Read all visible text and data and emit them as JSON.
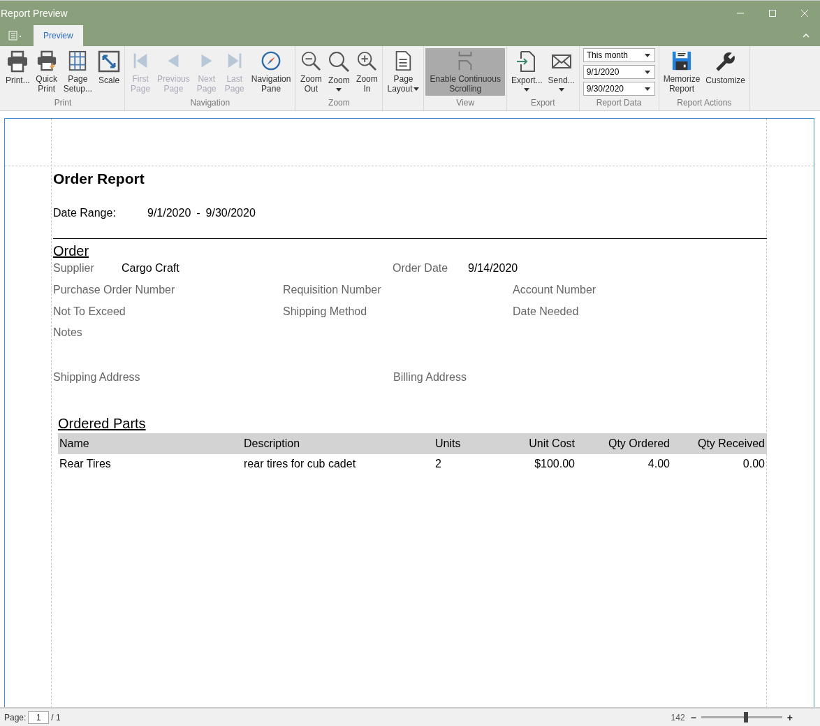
{
  "window": {
    "title": "Report Preview"
  },
  "tabs": [
    {
      "label": "Preview",
      "selected": true
    }
  ],
  "ribbon": [
    {
      "label": "Print",
      "buttons": [
        {
          "lines": [
            "Print..."
          ],
          "disabled": false
        },
        {
          "lines": [
            "Quick",
            "Print"
          ],
          "disabled": false
        },
        {
          "lines": [
            "Page",
            "Setup..."
          ],
          "disabled": false
        },
        {
          "lines": [
            "Scale"
          ],
          "disabled": false
        }
      ]
    },
    {
      "label": "Navigation",
      "buttons": [
        {
          "lines": [
            "First",
            "Page"
          ],
          "disabled": true
        },
        {
          "lines": [
            "Previous",
            "Page"
          ],
          "disabled": true
        },
        {
          "lines": [
            "Next",
            "Page"
          ],
          "disabled": true
        },
        {
          "lines": [
            "Last",
            "Page"
          ],
          "disabled": true
        },
        {
          "lines": [
            "Navigation",
            "Pane"
          ],
          "disabled": false
        }
      ]
    },
    {
      "label": "Zoom",
      "buttons": [
        {
          "lines": [
            "Zoom",
            "Out"
          ],
          "disabled": false
        },
        {
          "lines": [
            "Zoom"
          ],
          "disabled": false,
          "dropdown": true
        },
        {
          "lines": [
            "Zoom",
            "In"
          ],
          "disabled": false
        }
      ]
    },
    {
      "buttons": [
        {
          "lines": [
            "Page",
            "Layout"
          ],
          "disabled": false,
          "dropdown": true
        }
      ]
    },
    {
      "label": "View",
      "buttons": [
        {
          "lines": [
            "Enable Continuous",
            "Scrolling"
          ],
          "disabled": false,
          "selected": true
        }
      ]
    },
    {
      "label": "Export",
      "buttons": [
        {
          "lines": [
            "Export..."
          ],
          "disabled": false,
          "dropdown": true
        },
        {
          "lines": [
            "Send..."
          ],
          "disabled": false,
          "dropdown": true
        }
      ]
    },
    {
      "label": "Report Data",
      "combos": [
        "This month",
        "9/1/2020",
        "9/30/2020"
      ]
    },
    {
      "label": "Report Actions",
      "buttons": [
        {
          "lines": [
            "Memorize",
            "Report"
          ],
          "disabled": false
        },
        {
          "lines": [
            "Customize"
          ],
          "disabled": false
        }
      ]
    }
  ],
  "report": {
    "title": "Order Report",
    "date_range_label": "Date Range:",
    "date_from": "9/1/2020",
    "date_sep": "-",
    "date_to": "9/30/2020",
    "section": "Order",
    "row1": [
      {
        "label": "Supplier",
        "value": "Cargo Craft"
      },
      {
        "label": "Order Date",
        "value": "9/14/2020"
      }
    ],
    "row2": [
      "Purchase Order Number",
      "Requisition Number",
      "Account Number"
    ],
    "row3": [
      "Not To Exceed",
      "Shipping Method",
      "Date Needed"
    ],
    "notes": "Notes",
    "addresses": [
      "Shipping Address",
      "Billing Address"
    ],
    "parts_title": "Ordered Parts",
    "columns": [
      "Name",
      "Description",
      "Units",
      "Unit Cost",
      "Qty Ordered",
      "Qty Received"
    ],
    "rows": [
      [
        "Rear Tires",
        "rear tires for cub cadet",
        "2",
        "$100.00",
        "4.00",
        "0.00"
      ]
    ]
  },
  "status_bar": {
    "page_label": "Page:",
    "page": "1",
    "page_total": "/ 1",
    "zoom": "142",
    "zoom_minus": "−",
    "zoom_plus": "+",
    "level": 0.55
  }
}
